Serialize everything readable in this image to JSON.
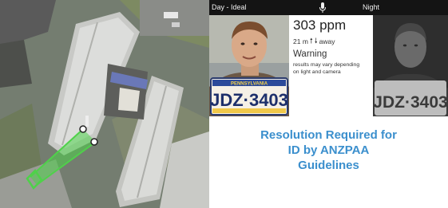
{
  "panel": {
    "day_label": "Day - Ideal",
    "night_label": "Night",
    "reading": {
      "value": "303 ppm",
      "distance": "21 m",
      "distance_suffix": "away",
      "status": "Warning",
      "note": "results may vary depending on light and camera"
    },
    "plate": {
      "state": "PENNSYLVANIA",
      "number": "JDZ·3403"
    },
    "caption": [
      "Resolution Required for",
      "ID by ANZPAA",
      "Guidelines"
    ]
  },
  "colors": {
    "caption": "#3b8fcd",
    "topbar": "#141414",
    "fov": "#4fd14a"
  },
  "icons": {
    "mic": "microphone-icon",
    "arrow_up": "arrow-up-icon",
    "arrow_down": "arrow-down-icon"
  }
}
